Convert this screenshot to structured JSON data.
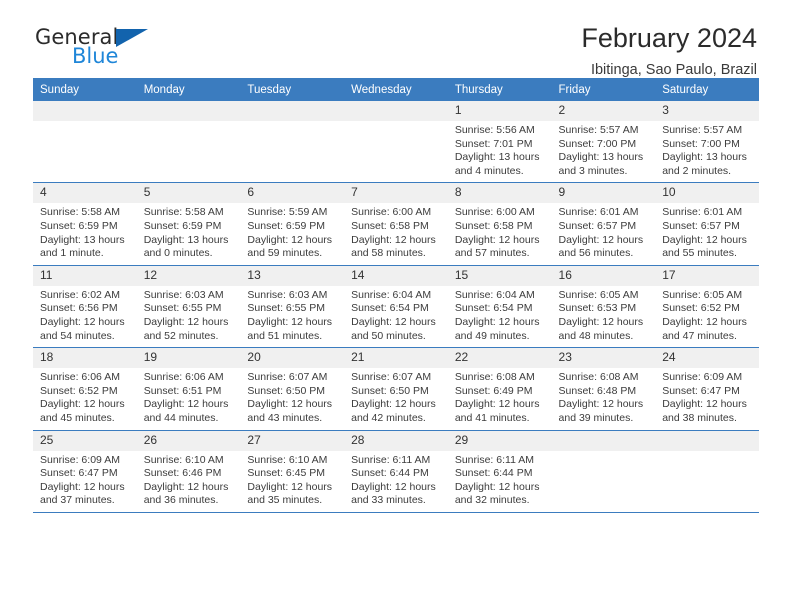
{
  "brand": {
    "name_part1": "General",
    "name_part2": "Blue",
    "triangle_color": "#1263ad",
    "blue_color": "#1f86d8"
  },
  "header": {
    "title": "February 2024",
    "subtitle": "Ibitinga, Sao Paulo, Brazil"
  },
  "theme": {
    "header_bg": "#3b7cbf",
    "daynum_bg": "#f0f0f0",
    "row_border": "#3b7cbf",
    "text": "#3c3c3c"
  },
  "weekdays": [
    "Sunday",
    "Monday",
    "Tuesday",
    "Wednesday",
    "Thursday",
    "Friday",
    "Saturday"
  ],
  "labels": {
    "sunrise": "Sunrise:",
    "sunset": "Sunset:",
    "daylight": "Daylight:"
  },
  "weeks": [
    [
      {
        "day": "",
        "sunrise": "",
        "sunset": "",
        "daylight": ""
      },
      {
        "day": "",
        "sunrise": "",
        "sunset": "",
        "daylight": ""
      },
      {
        "day": "",
        "sunrise": "",
        "sunset": "",
        "daylight": ""
      },
      {
        "day": "",
        "sunrise": "",
        "sunset": "",
        "daylight": ""
      },
      {
        "day": "1",
        "sunrise": "Sunrise: 5:56 AM",
        "sunset": "Sunset: 7:01 PM",
        "daylight": "Daylight: 13 hours and 4 minutes."
      },
      {
        "day": "2",
        "sunrise": "Sunrise: 5:57 AM",
        "sunset": "Sunset: 7:00 PM",
        "daylight": "Daylight: 13 hours and 3 minutes."
      },
      {
        "day": "3",
        "sunrise": "Sunrise: 5:57 AM",
        "sunset": "Sunset: 7:00 PM",
        "daylight": "Daylight: 13 hours and 2 minutes."
      }
    ],
    [
      {
        "day": "4",
        "sunrise": "Sunrise: 5:58 AM",
        "sunset": "Sunset: 6:59 PM",
        "daylight": "Daylight: 13 hours and 1 minute."
      },
      {
        "day": "5",
        "sunrise": "Sunrise: 5:58 AM",
        "sunset": "Sunset: 6:59 PM",
        "daylight": "Daylight: 13 hours and 0 minutes."
      },
      {
        "day": "6",
        "sunrise": "Sunrise: 5:59 AM",
        "sunset": "Sunset: 6:59 PM",
        "daylight": "Daylight: 12 hours and 59 minutes."
      },
      {
        "day": "7",
        "sunrise": "Sunrise: 6:00 AM",
        "sunset": "Sunset: 6:58 PM",
        "daylight": "Daylight: 12 hours and 58 minutes."
      },
      {
        "day": "8",
        "sunrise": "Sunrise: 6:00 AM",
        "sunset": "Sunset: 6:58 PM",
        "daylight": "Daylight: 12 hours and 57 minutes."
      },
      {
        "day": "9",
        "sunrise": "Sunrise: 6:01 AM",
        "sunset": "Sunset: 6:57 PM",
        "daylight": "Daylight: 12 hours and 56 minutes."
      },
      {
        "day": "10",
        "sunrise": "Sunrise: 6:01 AM",
        "sunset": "Sunset: 6:57 PM",
        "daylight": "Daylight: 12 hours and 55 minutes."
      }
    ],
    [
      {
        "day": "11",
        "sunrise": "Sunrise: 6:02 AM",
        "sunset": "Sunset: 6:56 PM",
        "daylight": "Daylight: 12 hours and 54 minutes."
      },
      {
        "day": "12",
        "sunrise": "Sunrise: 6:03 AM",
        "sunset": "Sunset: 6:55 PM",
        "daylight": "Daylight: 12 hours and 52 minutes."
      },
      {
        "day": "13",
        "sunrise": "Sunrise: 6:03 AM",
        "sunset": "Sunset: 6:55 PM",
        "daylight": "Daylight: 12 hours and 51 minutes."
      },
      {
        "day": "14",
        "sunrise": "Sunrise: 6:04 AM",
        "sunset": "Sunset: 6:54 PM",
        "daylight": "Daylight: 12 hours and 50 minutes."
      },
      {
        "day": "15",
        "sunrise": "Sunrise: 6:04 AM",
        "sunset": "Sunset: 6:54 PM",
        "daylight": "Daylight: 12 hours and 49 minutes."
      },
      {
        "day": "16",
        "sunrise": "Sunrise: 6:05 AM",
        "sunset": "Sunset: 6:53 PM",
        "daylight": "Daylight: 12 hours and 48 minutes."
      },
      {
        "day": "17",
        "sunrise": "Sunrise: 6:05 AM",
        "sunset": "Sunset: 6:52 PM",
        "daylight": "Daylight: 12 hours and 47 minutes."
      }
    ],
    [
      {
        "day": "18",
        "sunrise": "Sunrise: 6:06 AM",
        "sunset": "Sunset: 6:52 PM",
        "daylight": "Daylight: 12 hours and 45 minutes."
      },
      {
        "day": "19",
        "sunrise": "Sunrise: 6:06 AM",
        "sunset": "Sunset: 6:51 PM",
        "daylight": "Daylight: 12 hours and 44 minutes."
      },
      {
        "day": "20",
        "sunrise": "Sunrise: 6:07 AM",
        "sunset": "Sunset: 6:50 PM",
        "daylight": "Daylight: 12 hours and 43 minutes."
      },
      {
        "day": "21",
        "sunrise": "Sunrise: 6:07 AM",
        "sunset": "Sunset: 6:50 PM",
        "daylight": "Daylight: 12 hours and 42 minutes."
      },
      {
        "day": "22",
        "sunrise": "Sunrise: 6:08 AM",
        "sunset": "Sunset: 6:49 PM",
        "daylight": "Daylight: 12 hours and 41 minutes."
      },
      {
        "day": "23",
        "sunrise": "Sunrise: 6:08 AM",
        "sunset": "Sunset: 6:48 PM",
        "daylight": "Daylight: 12 hours and 39 minutes."
      },
      {
        "day": "24",
        "sunrise": "Sunrise: 6:09 AM",
        "sunset": "Sunset: 6:47 PM",
        "daylight": "Daylight: 12 hours and 38 minutes."
      }
    ],
    [
      {
        "day": "25",
        "sunrise": "Sunrise: 6:09 AM",
        "sunset": "Sunset: 6:47 PM",
        "daylight": "Daylight: 12 hours and 37 minutes."
      },
      {
        "day": "26",
        "sunrise": "Sunrise: 6:10 AM",
        "sunset": "Sunset: 6:46 PM",
        "daylight": "Daylight: 12 hours and 36 minutes."
      },
      {
        "day": "27",
        "sunrise": "Sunrise: 6:10 AM",
        "sunset": "Sunset: 6:45 PM",
        "daylight": "Daylight: 12 hours and 35 minutes."
      },
      {
        "day": "28",
        "sunrise": "Sunrise: 6:11 AM",
        "sunset": "Sunset: 6:44 PM",
        "daylight": "Daylight: 12 hours and 33 minutes."
      },
      {
        "day": "29",
        "sunrise": "Sunrise: 6:11 AM",
        "sunset": "Sunset: 6:44 PM",
        "daylight": "Daylight: 12 hours and 32 minutes."
      },
      {
        "day": "",
        "sunrise": "",
        "sunset": "",
        "daylight": ""
      },
      {
        "day": "",
        "sunrise": "",
        "sunset": "",
        "daylight": ""
      }
    ]
  ]
}
